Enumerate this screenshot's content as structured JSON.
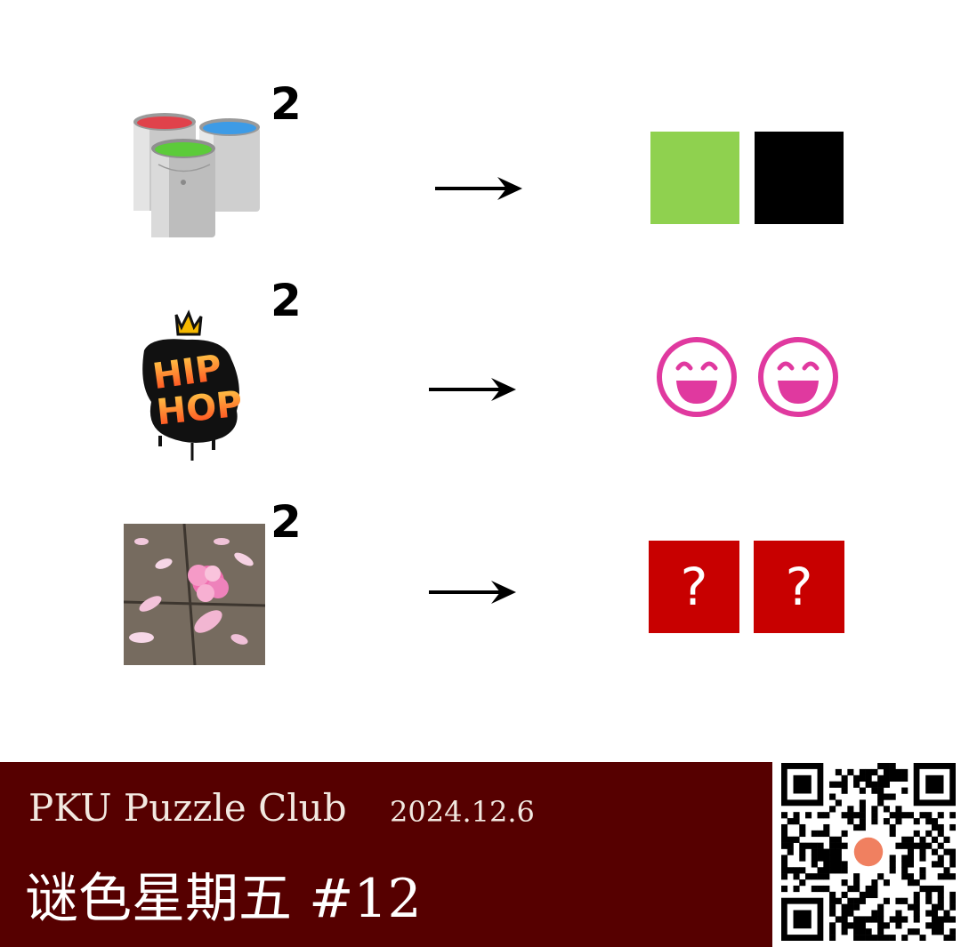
{
  "rows": [
    {
      "picture": "paint-buckets",
      "exponent": "2",
      "result": {
        "type": "color-squares",
        "colors": [
          "#8fd14f",
          "#000000"
        ]
      }
    },
    {
      "picture": "hip-hop-graffiti",
      "exponent": "2",
      "result": {
        "type": "smileys",
        "color": "#e0399f"
      }
    },
    {
      "picture": "pink-flower-petals",
      "exponent": "2",
      "result": {
        "type": "question-boxes",
        "marks": [
          "?",
          "?"
        ],
        "color": "#c80000"
      }
    }
  ],
  "graffiti_text": [
    "HIP",
    "HOP"
  ],
  "footer": {
    "club": "PKU Puzzle Club",
    "date": "2024.12.6",
    "title": "谜色星期五 #12",
    "background": "#560000"
  }
}
